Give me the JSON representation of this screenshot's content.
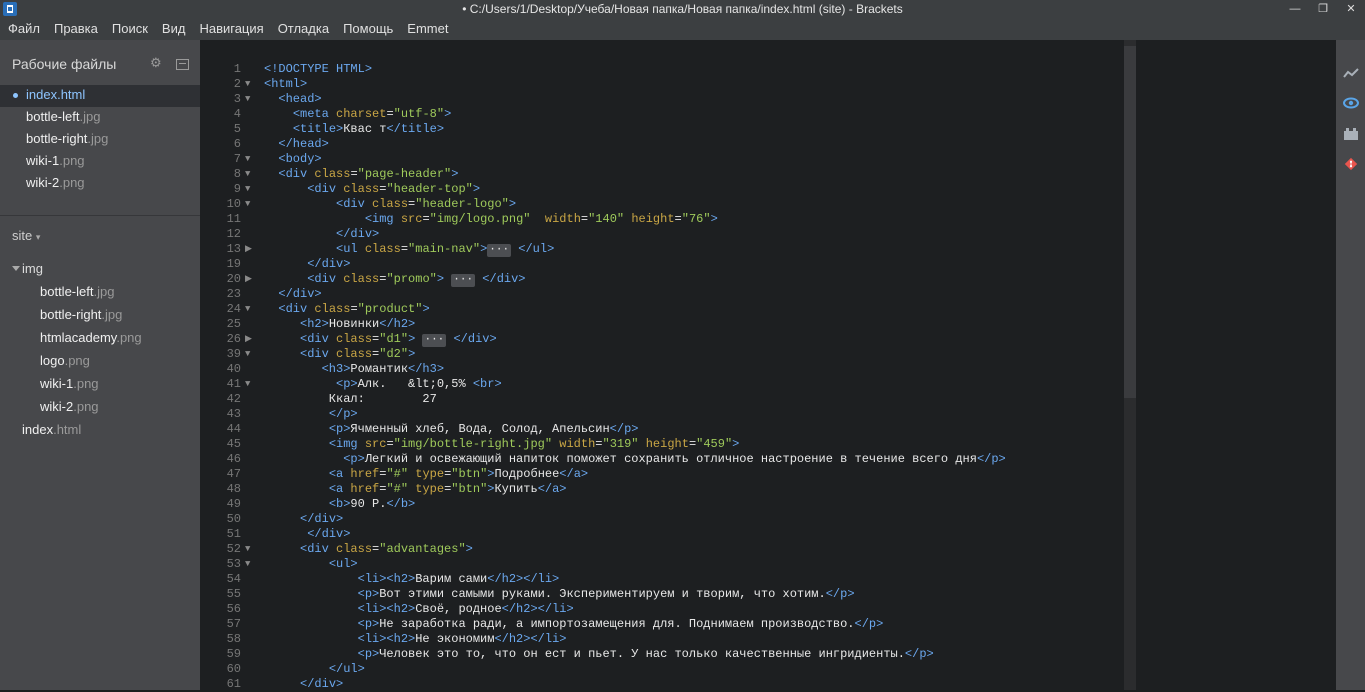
{
  "window": {
    "title": "• C:/Users/1/Desktop/Учеба/Новая папка/Новая папка/index.html (site) - Brackets",
    "controls": {
      "minimize": "—",
      "maximize": "❐",
      "close": "✕"
    }
  },
  "menu": [
    "Файл",
    "Правка",
    "Поиск",
    "Вид",
    "Навигация",
    "Отладка",
    "Помощь",
    "Emmet"
  ],
  "sidebar": {
    "working_files_title": "Рабочие файлы",
    "working_files": [
      {
        "name": "index",
        "ext": ".html",
        "active": true
      },
      {
        "name": "bottle-left",
        "ext": ".jpg"
      },
      {
        "name": "bottle-right",
        "ext": ".jpg"
      },
      {
        "name": "wiki-1",
        "ext": ".png"
      },
      {
        "name": "wiki-2",
        "ext": ".png"
      }
    ],
    "project_name": "site",
    "project_caret": "▾",
    "tree": [
      {
        "name": "img",
        "ext": "",
        "folder": true,
        "depth": 0
      },
      {
        "name": "bottle-left",
        "ext": ".jpg",
        "depth": 1
      },
      {
        "name": "bottle-right",
        "ext": ".jpg",
        "depth": 1
      },
      {
        "name": "htmlacademy",
        "ext": ".png",
        "depth": 1
      },
      {
        "name": "logo",
        "ext": ".png",
        "depth": 1
      },
      {
        "name": "wiki-1",
        "ext": ".png",
        "depth": 1
      },
      {
        "name": "wiki-2",
        "ext": ".png",
        "depth": 1
      },
      {
        "name": "index",
        "ext": ".html",
        "depth": 0
      }
    ]
  },
  "editor": {
    "lines": [
      {
        "n": "1",
        "fold": "",
        "tokens": [
          [
            "t",
            "<!DOCTYPE HTML>"
          ]
        ]
      },
      {
        "n": "2",
        "fold": "▼",
        "tokens": [
          [
            "t",
            "<html>"
          ]
        ]
      },
      {
        "n": "3",
        "fold": "▼",
        "tokens": [
          [
            "x",
            "  "
          ],
          [
            "t",
            "<head>"
          ]
        ]
      },
      {
        "n": "4",
        "fold": "",
        "tokens": [
          [
            "x",
            "    "
          ],
          [
            "t",
            "<meta "
          ],
          [
            "a",
            "charset"
          ],
          [
            "x",
            "="
          ],
          [
            "s",
            "\"utf-8\""
          ],
          [
            "t",
            ">"
          ]
        ]
      },
      {
        "n": "5",
        "fold": "",
        "tokens": [
          [
            "x",
            "    "
          ],
          [
            "t",
            "<title>"
          ],
          [
            "x",
            "Квас т"
          ],
          [
            "t",
            "</title>"
          ]
        ]
      },
      {
        "n": "6",
        "fold": "",
        "tokens": [
          [
            "x",
            "  "
          ],
          [
            "t",
            "</head>"
          ]
        ]
      },
      {
        "n": "7",
        "fold": "▼",
        "tokens": [
          [
            "x",
            "  "
          ],
          [
            "t",
            "<body>"
          ]
        ]
      },
      {
        "n": "8",
        "fold": "▼",
        "tokens": [
          [
            "x",
            "  "
          ],
          [
            "t",
            "<div "
          ],
          [
            "a",
            "class"
          ],
          [
            "x",
            "="
          ],
          [
            "s",
            "\"page-header\""
          ],
          [
            "t",
            ">"
          ]
        ]
      },
      {
        "n": "9",
        "fold": "▼",
        "tokens": [
          [
            "x",
            "      "
          ],
          [
            "t",
            "<div "
          ],
          [
            "a",
            "class"
          ],
          [
            "x",
            "="
          ],
          [
            "s",
            "\"header-top\""
          ],
          [
            "t",
            ">"
          ]
        ]
      },
      {
        "n": "10",
        "fold": "▼",
        "tokens": [
          [
            "x",
            "          "
          ],
          [
            "t",
            "<div "
          ],
          [
            "a",
            "class"
          ],
          [
            "x",
            "="
          ],
          [
            "s",
            "\"header-logo\""
          ],
          [
            "t",
            ">"
          ]
        ]
      },
      {
        "n": "11",
        "fold": "",
        "tokens": [
          [
            "x",
            "              "
          ],
          [
            "t",
            "<img "
          ],
          [
            "a",
            "src"
          ],
          [
            "x",
            "="
          ],
          [
            "s",
            "\"img/logo.png\""
          ],
          [
            "x",
            "  "
          ],
          [
            "a",
            "width"
          ],
          [
            "x",
            "="
          ],
          [
            "s",
            "\"140\""
          ],
          [
            "x",
            " "
          ],
          [
            "a",
            "height"
          ],
          [
            "x",
            "="
          ],
          [
            "s",
            "\"76\""
          ],
          [
            "t",
            ">"
          ]
        ]
      },
      {
        "n": "12",
        "fold": "",
        "tokens": [
          [
            "x",
            "          "
          ],
          [
            "t",
            "</div>"
          ]
        ]
      },
      {
        "n": "13",
        "fold": "▶",
        "tokens": [
          [
            "x",
            "          "
          ],
          [
            "t",
            "<ul "
          ],
          [
            "a",
            "class"
          ],
          [
            "x",
            "="
          ],
          [
            "s",
            "\"main-nav\""
          ],
          [
            "t",
            ">"
          ],
          [
            "f",
            "···"
          ],
          [
            "x",
            " "
          ],
          [
            "t",
            "</ul>"
          ]
        ]
      },
      {
        "n": "19",
        "fold": "",
        "tokens": [
          [
            "x",
            "      "
          ],
          [
            "t",
            "</div>"
          ]
        ]
      },
      {
        "n": "20",
        "fold": "▶",
        "tokens": [
          [
            "x",
            "      "
          ],
          [
            "t",
            "<div "
          ],
          [
            "a",
            "class"
          ],
          [
            "x",
            "="
          ],
          [
            "s",
            "\"promo\""
          ],
          [
            "t",
            ">"
          ],
          [
            "x",
            " "
          ],
          [
            "f",
            "···"
          ],
          [
            "x",
            " "
          ],
          [
            "t",
            "</div>"
          ]
        ]
      },
      {
        "n": "23",
        "fold": "",
        "tokens": [
          [
            "x",
            "  "
          ],
          [
            "t",
            "</div>"
          ]
        ]
      },
      {
        "n": "24",
        "fold": "▼",
        "tokens": [
          [
            "x",
            "  "
          ],
          [
            "t",
            "<div "
          ],
          [
            "a",
            "class"
          ],
          [
            "x",
            "="
          ],
          [
            "s",
            "\"product\""
          ],
          [
            "t",
            ">"
          ]
        ]
      },
      {
        "n": "25",
        "fold": "",
        "tokens": [
          [
            "x",
            "     "
          ],
          [
            "t",
            "<h2>"
          ],
          [
            "x",
            "Новинки"
          ],
          [
            "t",
            "</h2>"
          ]
        ]
      },
      {
        "n": "26",
        "fold": "▶",
        "tokens": [
          [
            "x",
            "     "
          ],
          [
            "t",
            "<div "
          ],
          [
            "a",
            "class"
          ],
          [
            "x",
            "="
          ],
          [
            "s",
            "\"d1\""
          ],
          [
            "t",
            ">"
          ],
          [
            "x",
            " "
          ],
          [
            "f",
            "···"
          ],
          [
            "x",
            " "
          ],
          [
            "t",
            "</div>"
          ]
        ]
      },
      {
        "n": "39",
        "fold": "▼",
        "tokens": [
          [
            "x",
            "     "
          ],
          [
            "t",
            "<div "
          ],
          [
            "a",
            "class"
          ],
          [
            "x",
            "="
          ],
          [
            "s",
            "\"d2\""
          ],
          [
            "t",
            ">"
          ]
        ]
      },
      {
        "n": "40",
        "fold": "",
        "tokens": [
          [
            "x",
            "        "
          ],
          [
            "t",
            "<h3>"
          ],
          [
            "x",
            "Романтик"
          ],
          [
            "t",
            "</h3>"
          ]
        ]
      },
      {
        "n": "41",
        "fold": "▼",
        "tokens": [
          [
            "x",
            "          "
          ],
          [
            "t",
            "<p>"
          ],
          [
            "x",
            "Алк.   &lt;0,5% "
          ],
          [
            "t",
            "<br>"
          ]
        ]
      },
      {
        "n": "42",
        "fold": "",
        "tokens": [
          [
            "x",
            "         Ккал:        27"
          ]
        ]
      },
      {
        "n": "43",
        "fold": "",
        "tokens": [
          [
            "x",
            "         "
          ],
          [
            "t",
            "</p>"
          ]
        ]
      },
      {
        "n": "44",
        "fold": "",
        "tokens": [
          [
            "x",
            "         "
          ],
          [
            "t",
            "<p>"
          ],
          [
            "x",
            "Ячменный хлеб, Вода, Солод, Апельсин"
          ],
          [
            "t",
            "</p>"
          ]
        ]
      },
      {
        "n": "45",
        "fold": "",
        "tokens": [
          [
            "x",
            "         "
          ],
          [
            "t",
            "<img "
          ],
          [
            "a",
            "src"
          ],
          [
            "x",
            "="
          ],
          [
            "s",
            "\"img/bottle-right.jpg\""
          ],
          [
            "x",
            " "
          ],
          [
            "a",
            "width"
          ],
          [
            "x",
            "="
          ],
          [
            "s",
            "\"319\""
          ],
          [
            "x",
            " "
          ],
          [
            "a",
            "height"
          ],
          [
            "x",
            "="
          ],
          [
            "s",
            "\"459\""
          ],
          [
            "t",
            ">"
          ]
        ]
      },
      {
        "n": "46",
        "fold": "",
        "tokens": [
          [
            "x",
            "           "
          ],
          [
            "t",
            "<p>"
          ],
          [
            "x",
            "Легкий и освежающий напиток поможет сохранить отличное настроение в течение всего дня"
          ],
          [
            "t",
            "</p>"
          ]
        ]
      },
      {
        "n": "47",
        "fold": "",
        "tokens": [
          [
            "x",
            "         "
          ],
          [
            "t",
            "<a "
          ],
          [
            "a",
            "href"
          ],
          [
            "x",
            "="
          ],
          [
            "s",
            "\"#\""
          ],
          [
            "x",
            " "
          ],
          [
            "a",
            "type"
          ],
          [
            "x",
            "="
          ],
          [
            "s",
            "\"btn\""
          ],
          [
            "t",
            ">"
          ],
          [
            "x",
            "Подробнее"
          ],
          [
            "t",
            "</a>"
          ]
        ]
      },
      {
        "n": "48",
        "fold": "",
        "tokens": [
          [
            "x",
            "         "
          ],
          [
            "t",
            "<a "
          ],
          [
            "a",
            "href"
          ],
          [
            "x",
            "="
          ],
          [
            "s",
            "\"#\""
          ],
          [
            "x",
            " "
          ],
          [
            "a",
            "type"
          ],
          [
            "x",
            "="
          ],
          [
            "s",
            "\"btn\""
          ],
          [
            "t",
            ">"
          ],
          [
            "x",
            "Купить"
          ],
          [
            "t",
            "</a>"
          ]
        ]
      },
      {
        "n": "49",
        "fold": "",
        "tokens": [
          [
            "x",
            "         "
          ],
          [
            "t",
            "<b>"
          ],
          [
            "x",
            "90 Р."
          ],
          [
            "t",
            "</b>"
          ]
        ]
      },
      {
        "n": "50",
        "fold": "",
        "tokens": [
          [
            "x",
            "     "
          ],
          [
            "t",
            "</div>"
          ]
        ]
      },
      {
        "n": "51",
        "fold": "",
        "tokens": [
          [
            "x",
            "      "
          ],
          [
            "t",
            "</div>"
          ]
        ]
      },
      {
        "n": "52",
        "fold": "▼",
        "tokens": [
          [
            "x",
            "     "
          ],
          [
            "t",
            "<div "
          ],
          [
            "a",
            "class"
          ],
          [
            "x",
            "="
          ],
          [
            "s",
            "\"advantages\""
          ],
          [
            "t",
            ">"
          ]
        ]
      },
      {
        "n": "53",
        "fold": "▼",
        "tokens": [
          [
            "x",
            "         "
          ],
          [
            "t",
            "<ul>"
          ]
        ]
      },
      {
        "n": "54",
        "fold": "",
        "tokens": [
          [
            "x",
            "             "
          ],
          [
            "t",
            "<li><h2>"
          ],
          [
            "x",
            "Варим сами"
          ],
          [
            "t",
            "</h2></li>"
          ]
        ]
      },
      {
        "n": "55",
        "fold": "",
        "tokens": [
          [
            "x",
            "             "
          ],
          [
            "t",
            "<p>"
          ],
          [
            "x",
            "Вот этими самыми руками. Экспериментируем и творим, что хотим."
          ],
          [
            "t",
            "</p>"
          ]
        ]
      },
      {
        "n": "56",
        "fold": "",
        "tokens": [
          [
            "x",
            "             "
          ],
          [
            "t",
            "<li><h2>"
          ],
          [
            "x",
            "Своё, родное"
          ],
          [
            "t",
            "</h2></li>"
          ]
        ]
      },
      {
        "n": "57",
        "fold": "",
        "tokens": [
          [
            "x",
            "             "
          ],
          [
            "t",
            "<p>"
          ],
          [
            "x",
            "Не заработка ради, а импортозамещения для. Поднимаем производство."
          ],
          [
            "t",
            "</p>"
          ]
        ]
      },
      {
        "n": "58",
        "fold": "",
        "tokens": [
          [
            "x",
            "             "
          ],
          [
            "t",
            "<li><h2>"
          ],
          [
            "x",
            "Не экономим"
          ],
          [
            "t",
            "</h2></li>"
          ]
        ]
      },
      {
        "n": "59",
        "fold": "",
        "tokens": [
          [
            "x",
            "             "
          ],
          [
            "t",
            "<p>"
          ],
          [
            "x",
            "Человек это то, что он ест и пьет. У нас только качественные ингридиенты."
          ],
          [
            "t",
            "</p>"
          ]
        ]
      },
      {
        "n": "60",
        "fold": "",
        "tokens": [
          [
            "x",
            "         "
          ],
          [
            "t",
            "</ul>"
          ]
        ]
      },
      {
        "n": "61",
        "fold": "",
        "tokens": [
          [
            "x",
            "     "
          ],
          [
            "t",
            "</div>"
          ]
        ]
      }
    ]
  },
  "right_toolbar": [
    "live-preview-icon",
    "eye-icon",
    "extension-manager-icon",
    "git-icon"
  ]
}
